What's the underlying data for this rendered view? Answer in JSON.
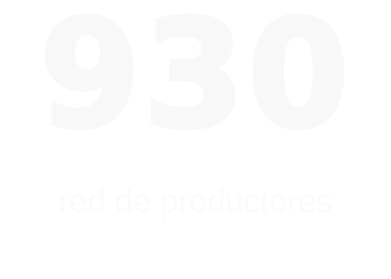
{
  "stat": {
    "number": "930",
    "caption": "red de productores"
  }
}
